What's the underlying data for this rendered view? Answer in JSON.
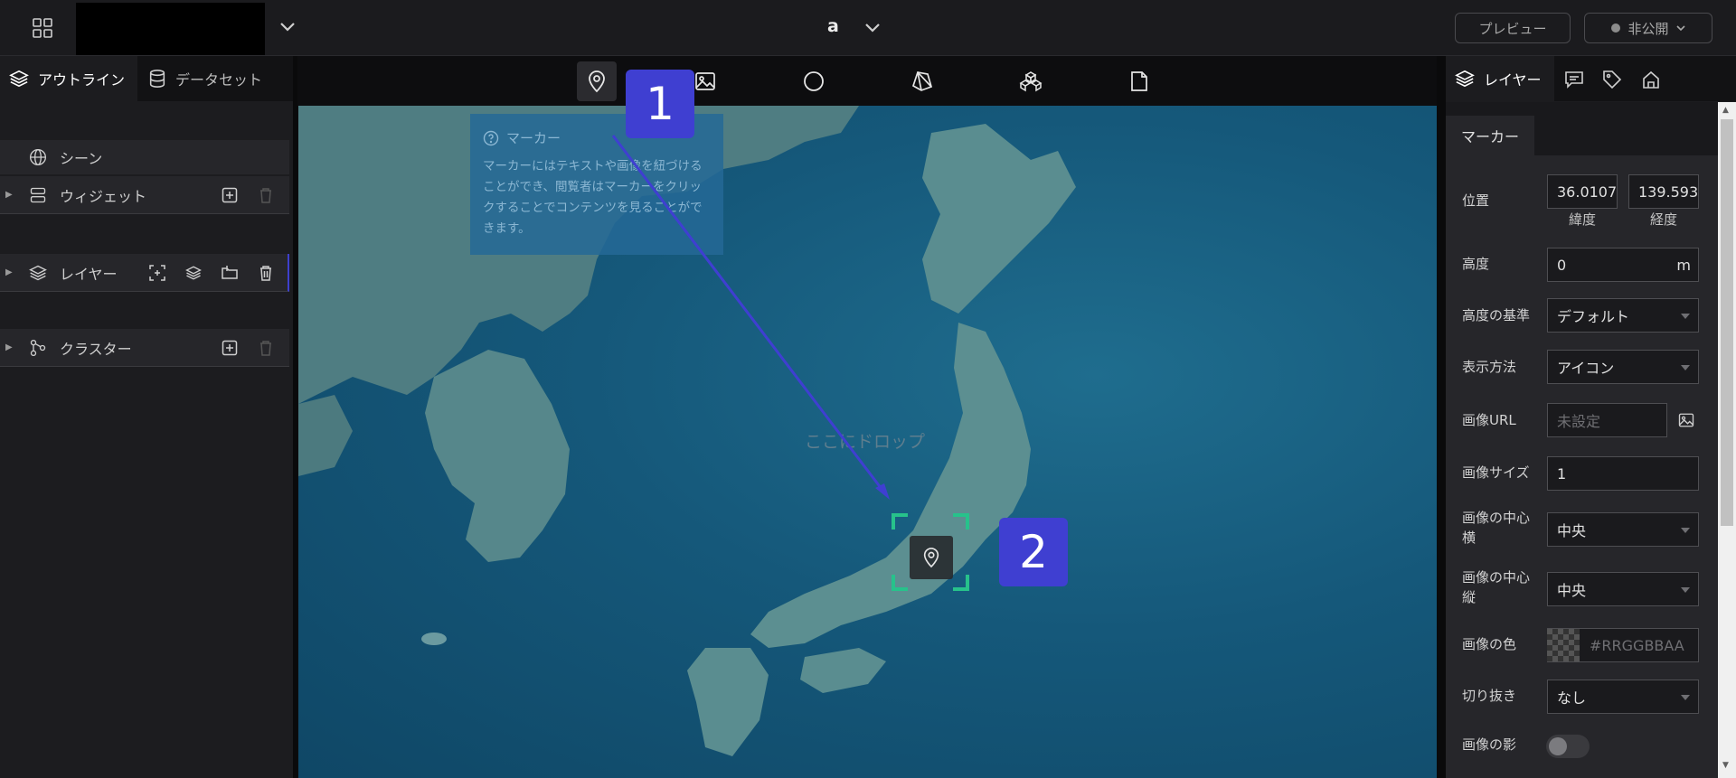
{
  "header": {
    "scene_title": "a",
    "preview_label": "プレビュー",
    "publish_label": "非公開"
  },
  "left_panel": {
    "tabs": [
      {
        "label": "アウトライン",
        "icon": "layers-icon",
        "active": true
      },
      {
        "label": "データセット",
        "icon": "database-icon",
        "active": false
      }
    ],
    "tree": {
      "scene": "シーン",
      "widget": "ウィジェット",
      "layer": "レイヤー",
      "cluster": "クラスター"
    }
  },
  "toolbar": {
    "tools": [
      "marker-icon",
      "image-icon",
      "circle-icon",
      "cube-icon",
      "model-icon",
      "file-icon"
    ],
    "active_tool": "marker-icon"
  },
  "map": {
    "drop_text": "ここにドロップ"
  },
  "tooltip": {
    "title": "マーカー",
    "body": "マーカーにはテキストや画像を紐づけることができ、閲覧者はマーカーをクリックすることでコンテンツを見ることができます。"
  },
  "annotations": {
    "badge_1": "1",
    "badge_2": "2",
    "accent_color": "#3f3fd1",
    "selection_color": "#27c28b"
  },
  "right_panel": {
    "active_tab": "レイヤー",
    "tab_icons": [
      "comment-icon",
      "tag-icon",
      "infobox-icon"
    ],
    "section_tab": "マーカー",
    "properties": {
      "position_label": "位置",
      "latitude_value": "36.0107",
      "longitude_value": "139.593",
      "latitude_label": "緯度",
      "longitude_label": "経度",
      "height_label": "高度",
      "height_value": "0",
      "height_unit": "m",
      "height_ref_label": "高度の基準",
      "height_ref_value": "デフォルト",
      "display_label": "表示方法",
      "display_value": "アイコン",
      "image_url_label": "画像URL",
      "image_url_placeholder": "未設定",
      "image_size_label": "画像サイズ",
      "image_size_value": "1",
      "center_x_label": "画像の中心横",
      "center_x_value": "中央",
      "center_y_label": "画像の中心縦",
      "center_y_value": "中央",
      "color_label": "画像の色",
      "color_placeholder": "#RRGGBBAA",
      "crop_label": "切り抜き",
      "crop_value": "なし",
      "shadow_label": "画像の影",
      "shadow_enabled": false
    }
  }
}
